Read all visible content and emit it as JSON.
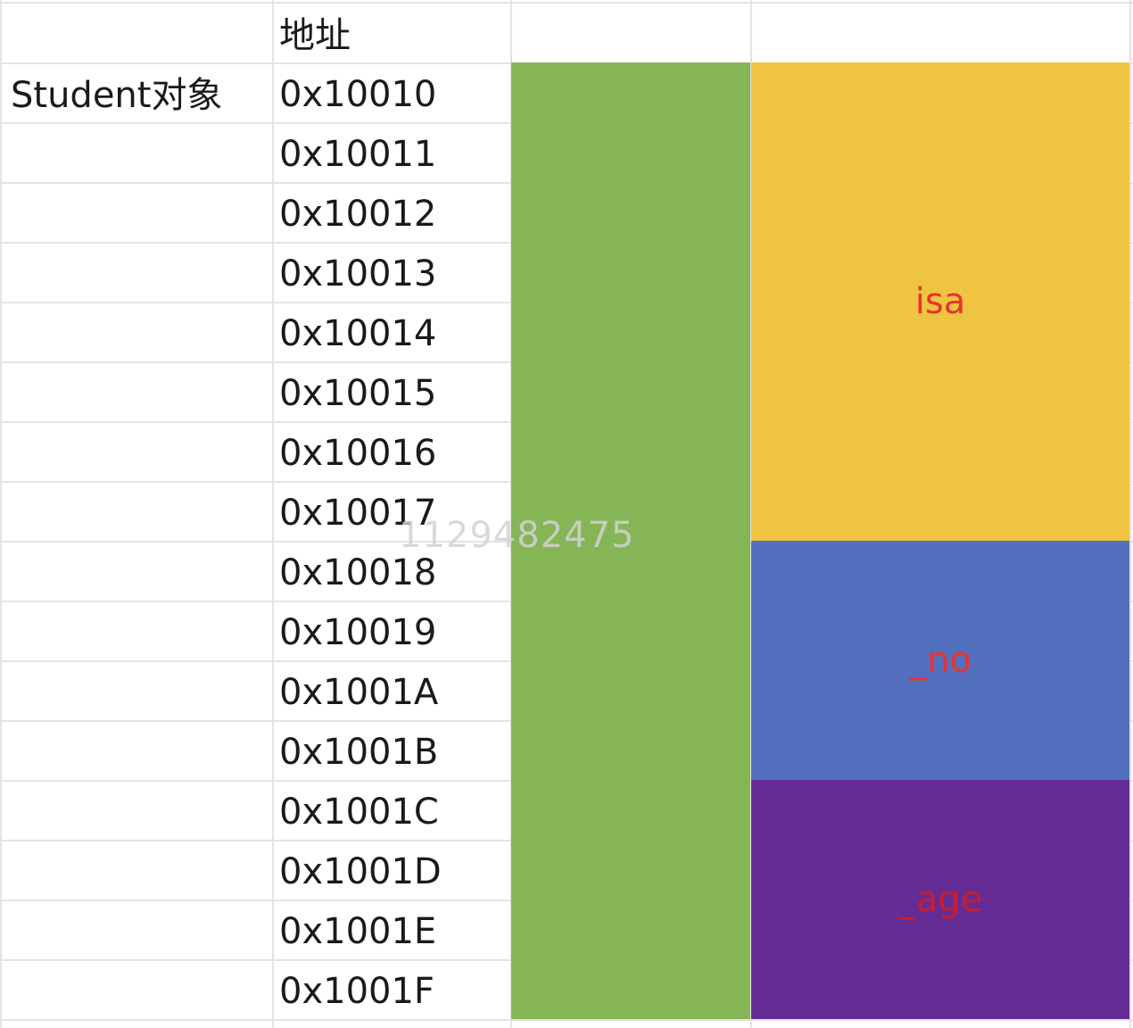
{
  "header": {
    "address_label": "地址"
  },
  "object_label": "Student对象",
  "addresses": [
    "0x10010",
    "0x10011",
    "0x10012",
    "0x10013",
    "0x10014",
    "0x10015",
    "0x10016",
    "0x10017",
    "0x10018",
    "0x10019",
    "0x1001A",
    "0x1001B",
    "0x1001C",
    "0x1001D",
    "0x1001E",
    "0x1001F"
  ],
  "memory_block": {
    "color": "#86b555"
  },
  "fields": [
    {
      "label": "isa",
      "color": "#eec441",
      "text_color": "#e8322e"
    },
    {
      "label": "_no",
      "color": "#5270be",
      "text_color": "#e8322e"
    },
    {
      "label": "_age",
      "color": "#652c95",
      "text_color": "#c81e2e"
    }
  ],
  "watermark": "1129482475"
}
